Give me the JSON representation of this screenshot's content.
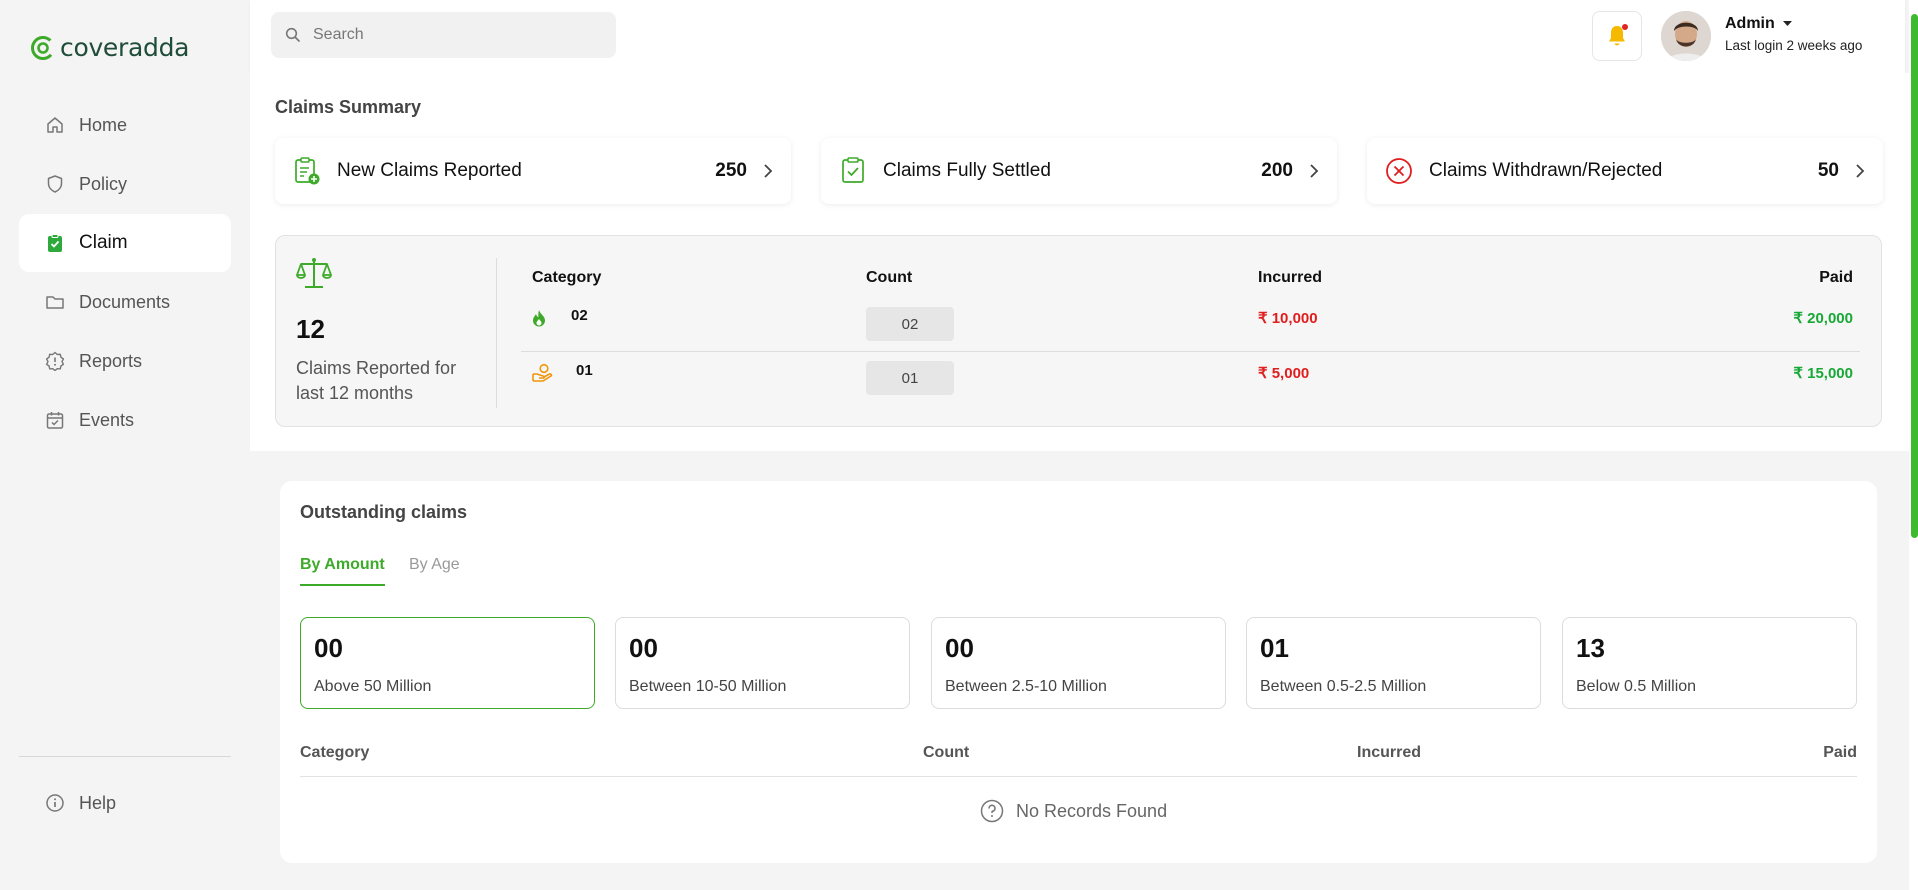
{
  "brand": {
    "name": "coveradda"
  },
  "sidebar": {
    "items": [
      {
        "label": "Home",
        "icon": "home-icon",
        "active": false
      },
      {
        "label": "Policy",
        "icon": "shield-icon",
        "active": false
      },
      {
        "label": "Claim",
        "icon": "clipboard-check-icon",
        "active": true
      },
      {
        "label": "Documents",
        "icon": "folder-icon",
        "active": false
      },
      {
        "label": "Reports",
        "icon": "badge-alert-icon",
        "active": false
      },
      {
        "label": "Events",
        "icon": "calendar-check-icon",
        "active": false
      }
    ],
    "help_label": "Help"
  },
  "header": {
    "search_placeholder": "Search",
    "user_name": "Admin",
    "last_login": "Last login 2 weeks ago"
  },
  "summary": {
    "title": "Claims Summary",
    "cards": [
      {
        "label": "New Claims Reported",
        "value": "250"
      },
      {
        "label": "Claims Fully Settled",
        "value": "200"
      },
      {
        "label": "Claims Withdrawn/Rejected",
        "value": "50"
      }
    ],
    "reported_count": "12",
    "reported_label": "Claims Reported for last 12 months",
    "table": {
      "headers": [
        "Category",
        "Count",
        "Incurred",
        "Paid"
      ],
      "rows": [
        {
          "category": "02",
          "icon": "fire-icon",
          "count": "02",
          "incurred": "₹ 10,000",
          "paid": "₹ 20,000"
        },
        {
          "category": "01",
          "icon": "hand-coin-icon",
          "count": "01",
          "incurred": "₹ 5,000",
          "paid": "₹ 15,000"
        }
      ]
    }
  },
  "outstanding": {
    "title": "Outstanding claims",
    "tabs": [
      {
        "label": "By Amount",
        "active": true
      },
      {
        "label": "By Age",
        "active": false
      }
    ],
    "buckets": [
      {
        "value": "00",
        "label": "Above 50 Million",
        "active": true
      },
      {
        "value": "00",
        "label": "Between 10-50 Million",
        "active": false
      },
      {
        "value": "00",
        "label": "Between 2.5-10 Million",
        "active": false
      },
      {
        "value": "01",
        "label": "Between 0.5-2.5 Million",
        "active": false
      },
      {
        "value": "13",
        "label": "Below 0.5 Million",
        "active": false
      }
    ],
    "table_headers": [
      "Category",
      "Count",
      "Incurred",
      "Paid"
    ],
    "empty_text": "No Records Found"
  },
  "colors": {
    "accent": "#3dab29",
    "danger": "#e01e1e",
    "success": "#18a836"
  }
}
